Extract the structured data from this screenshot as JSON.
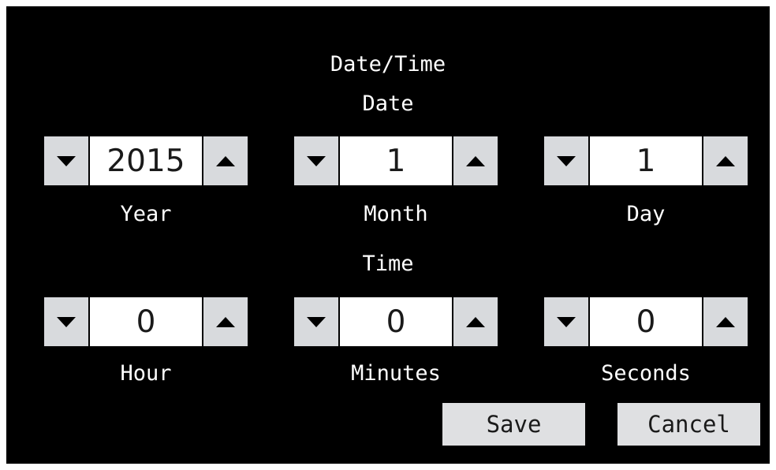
{
  "header": {
    "title": "Date/Time"
  },
  "date_section": {
    "heading": "Date",
    "fields": [
      {
        "label": "Year",
        "value": "2015"
      },
      {
        "label": "Month",
        "value": "1"
      },
      {
        "label": "Day",
        "value": "1"
      }
    ]
  },
  "time_section": {
    "heading": "Time",
    "fields": [
      {
        "label": "Hour",
        "value": "0"
      },
      {
        "label": "Minutes",
        "value": "0"
      },
      {
        "label": "Seconds",
        "value": "0"
      }
    ]
  },
  "actions": {
    "save_label": "Save",
    "cancel_label": "Cancel"
  },
  "icons": {
    "decrement": "triangle-down-icon",
    "increment": "triangle-up-icon"
  },
  "colors": {
    "background": "#000000",
    "button": "#d8dadd",
    "value_box": "#ffffff",
    "text": "#ffffff"
  }
}
